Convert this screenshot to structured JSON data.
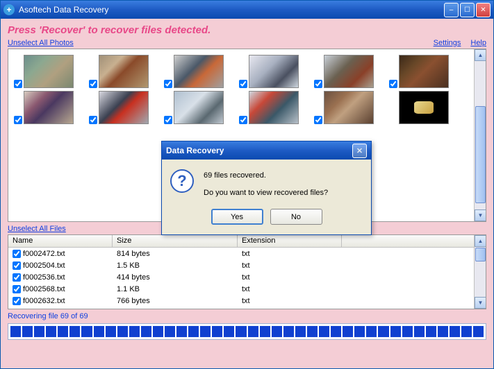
{
  "window": {
    "title": "Asoftech Data Recovery"
  },
  "instruction": "Press 'Recover' to recover files detected.",
  "links": {
    "unselect_photos": "Unselect All Photos",
    "unselect_files": "Unselect All Files",
    "settings": "Settings",
    "help": "Help"
  },
  "files_header": {
    "name": "Name",
    "size": "Size",
    "extension": "Extension"
  },
  "files": [
    {
      "name": "f0002472.txt",
      "size": "814 bytes",
      "ext": "txt"
    },
    {
      "name": "f0002504.txt",
      "size": "1.5 KB",
      "ext": "txt"
    },
    {
      "name": "f0002536.txt",
      "size": "414 bytes",
      "ext": "txt"
    },
    {
      "name": "f0002568.txt",
      "size": "1.1 KB",
      "ext": "txt"
    },
    {
      "name": "f0002632.txt",
      "size": "766 bytes",
      "ext": "txt"
    }
  ],
  "status": "Recovering file 69 of 69",
  "dialog": {
    "title": "Data Recovery",
    "line1": "69 files recovered.",
    "line2": "Do you want to view recovered files?",
    "yes": "Yes",
    "no": "No"
  }
}
